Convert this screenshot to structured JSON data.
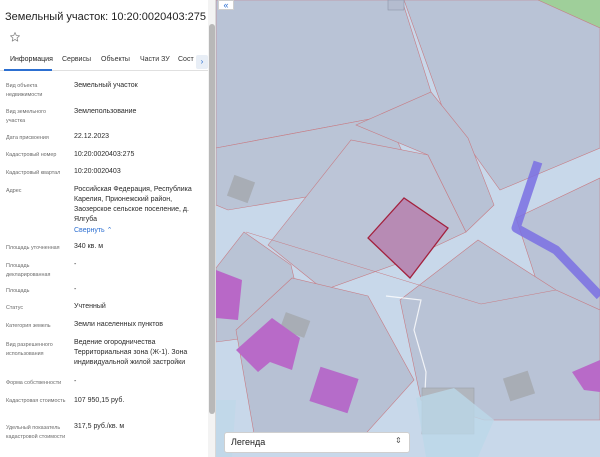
{
  "panel": {
    "title": "Земельный участок: 10:20:0020403:275",
    "tabs": [
      "Информация",
      "Сервисы",
      "Объекты",
      "Части ЗУ",
      "Сост"
    ],
    "expand_arrow": "›"
  },
  "rows": [
    {
      "label": "Вид объекта недвижимости",
      "value": "Земельный участок"
    },
    {
      "label": "Вид земельного участка",
      "value": "Землепользование"
    },
    {
      "label": "Дата присвоения",
      "value": "22.12.2023"
    },
    {
      "label": "Кадастровый номер",
      "value": "10:20:0020403:275"
    },
    {
      "label": "Кадастровый квартал",
      "value": "10:20:0020403"
    },
    {
      "label": "Адрес",
      "value": "Российская Федерация, Республика Карелия, Прионежский район, Заозерское сельское поселение, д. Ялгуба"
    },
    {
      "label": "Площадь уточненная",
      "value": "340 кв. м"
    },
    {
      "label": "Площадь декларированная",
      "value": "-"
    },
    {
      "label": "Площадь",
      "value": "-"
    },
    {
      "label": "Статус",
      "value": "Учтенный"
    },
    {
      "label": "Категория земель",
      "value": "Земли населенных пунктов"
    },
    {
      "label": "Вид разрешенного использования",
      "value": "Ведение огородничества Территориальная зона (Ж-1). Зона индивидуальной жилой застройки"
    },
    {
      "label": "Форма собственности",
      "value": "-"
    },
    {
      "label": "Кадастровая стоимость",
      "value": "107 950,15 руб."
    },
    {
      "label": "Удельный показатель кадастровой стоимости",
      "value": "317,5 руб./кв. м"
    }
  ],
  "collapse_link": "Свернуть",
  "map": {
    "collapse_button": "«",
    "legend_label": "Легенда",
    "legend_caret": "⇕"
  }
}
